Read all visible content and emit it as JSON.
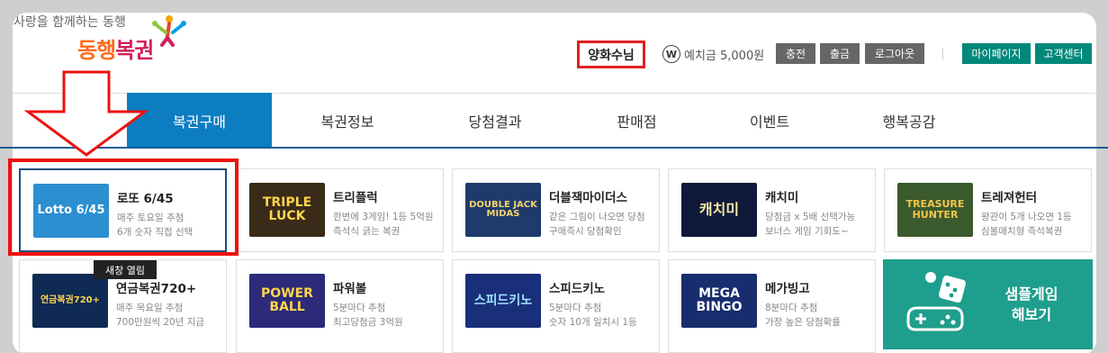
{
  "header": {
    "tagline": "사랑을 함께하는 동행",
    "logo_part1": "동행",
    "logo_part2": "복권",
    "user_name": "양화수님",
    "wallet_icon_glyph": "W",
    "deposit_text": "예치금 5,000원",
    "buttons": [
      "충전",
      "출금",
      "로그아웃"
    ],
    "links": [
      "마이페이지",
      "고객센터"
    ]
  },
  "nav": {
    "items": [
      "복권구매",
      "복권정보",
      "당첨결과",
      "판매점",
      "이벤트",
      "행복공감"
    ],
    "active_index": 0
  },
  "cards": [
    {
      "title": "로또 6/45",
      "desc1": "매주 토요일 추첨",
      "desc2": "6개 숫자 직접 선택",
      "thumb": "Lotto 6/45"
    },
    {
      "title": "트리플럭",
      "desc1": "한번에 3게임! 1등 5억원",
      "desc2": "즉석식 긁는 복권",
      "thumb": "TRIPLE LUCK"
    },
    {
      "title": "더블잭마이더스",
      "desc1": "같은 그림이 나오면 당첨",
      "desc2": "구매즉시 당첨확인",
      "thumb": "DOUBLE JACK MIDAS"
    },
    {
      "title": "캐치미",
      "desc1": "당첨금 x 5배 선택가능",
      "desc2": "보너스 게임 기회도~",
      "thumb": "캐치미"
    },
    {
      "title": "트레져헌터",
      "desc1": "왕관이 5개 나오면 1등",
      "desc2": "심볼매치형 즉석복권",
      "thumb": "TREASURE HUNTER"
    },
    {
      "title": "연금복권720+",
      "desc1": "매주 목요일 추첨",
      "desc2": "700만원씩 20년 지급",
      "thumb": "연금복권720+"
    },
    {
      "title": "파워볼",
      "desc1": "5분마다 추첨",
      "desc2": "최고당첨금 3억원",
      "thumb": "POWER BALL"
    },
    {
      "title": "스피드키노",
      "desc1": "5분마다 추첨",
      "desc2": "숫자 10개 일치시 1등",
      "thumb": "스피드키노"
    },
    {
      "title": "메가빙고",
      "desc1": "8분마다 추첨",
      "desc2": "가장 높은 당첨확률",
      "thumb": "MEGA BINGO"
    }
  ],
  "sample": {
    "line1": "샘플게임",
    "line2": "해보기"
  },
  "tooltip": "새창 열림",
  "colors": {
    "nav_active": "#0c7dc1",
    "green": "#00887a",
    "highlight": "#e11111",
    "sample": "#1e9e8c"
  }
}
